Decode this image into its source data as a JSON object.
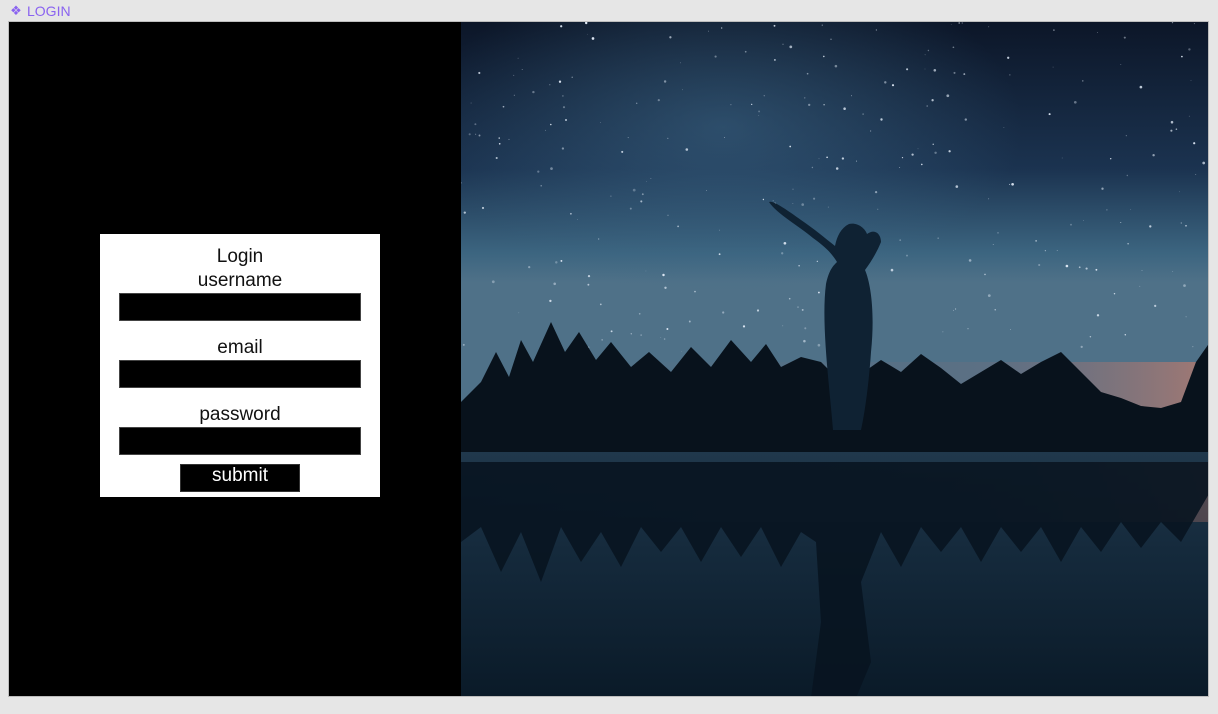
{
  "window": {
    "title": "LOGIN",
    "icon": "diamond-icon"
  },
  "login_form": {
    "title": "Login",
    "fields": [
      {
        "label": "username",
        "value": "",
        "placeholder": ""
      },
      {
        "label": "email",
        "value": "",
        "placeholder": ""
      },
      {
        "label": "password",
        "value": "",
        "placeholder": ""
      }
    ],
    "submit_label": "submit"
  },
  "colors": {
    "accent": "#8a63f0",
    "form_background": "#ffffff",
    "page_background": "#000000",
    "input_background": "#000000"
  },
  "hero_image": {
    "subject": "night-sky-lake-silhouette"
  }
}
